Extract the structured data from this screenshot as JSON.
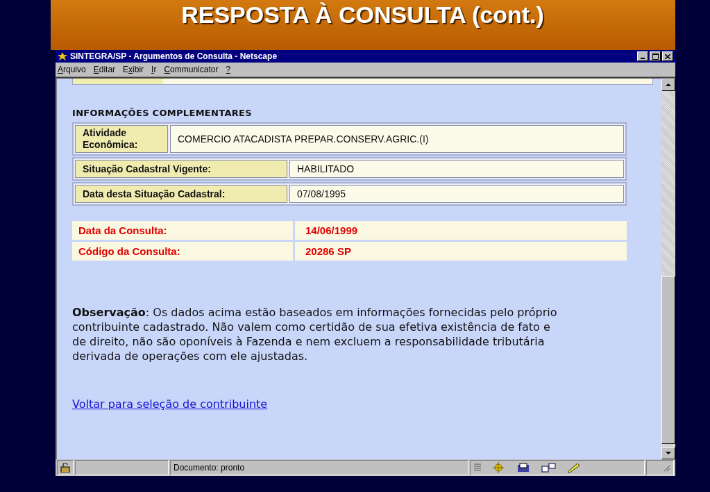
{
  "banner": {
    "title": "RESPOSTA À CONSULTA (cont.)"
  },
  "window": {
    "title": "SINTEGRA/SP - Argumentos de Consulta - Netscape"
  },
  "menu": [
    {
      "key": "A",
      "post": "rquivo"
    },
    {
      "key": "E",
      "post": "ditar"
    },
    {
      "pre": "E",
      "key": "x",
      "post": "ibir"
    },
    {
      "key": "I",
      "post": "r"
    },
    {
      "key": "C",
      "post": "ommunicator"
    },
    {
      "key": "?"
    }
  ],
  "section": {
    "heading": "INFORMAÇÕES COMPLEMENTARES",
    "activity": {
      "label": "Atividade Econômica:",
      "value": "COMERCIO ATACADISTA PREPAR.CONSERV.AGRIC.(I)"
    },
    "rows": [
      {
        "label": "Situação Cadastral Vigente:",
        "value": "HABILITADO"
      },
      {
        "label": "Data desta Situação Cadastral:",
        "value": "07/08/1995"
      }
    ]
  },
  "consulta": [
    {
      "label": "Data da Consulta:",
      "value": "14/06/1999"
    },
    {
      "label": "Código da Consulta:",
      "value": "20286 SP"
    }
  ],
  "observation": "**Observação**: Os dados acima estão baseados em informações fornecidas pelo próprio contribuinte cadastrado. Não valem como certidão de sua efetiva existência de fato e de direito, não são oponíveis à Fazenda e nem excluem a responsabilidade tributária derivada de operações com ele ajustadas.",
  "link": "Voltar para seleção de contribuinte",
  "status_bar": {
    "text": "Documento: pronto"
  }
}
